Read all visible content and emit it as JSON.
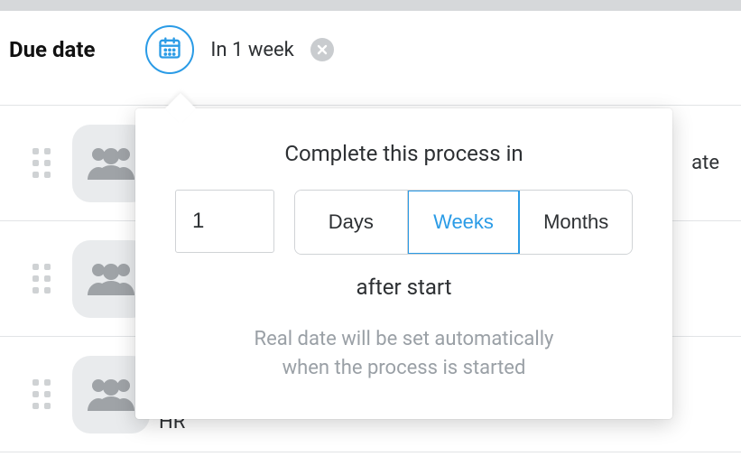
{
  "header": {
    "label": "Due date",
    "summary": "In 1 week"
  },
  "popover": {
    "title": "Complete this process in",
    "value": "1",
    "units": {
      "days": "Days",
      "weeks": "Weeks",
      "months": "Months"
    },
    "active_unit": "weeks",
    "after_label": "after start",
    "note_line1": "Real date will be set automatically",
    "note_line2": "when the process is started"
  },
  "rows": [
    {
      "right": "ate",
      "sub": ""
    },
    {
      "right": "",
      "sub": ""
    },
    {
      "right": "",
      "sub": "HR"
    }
  ]
}
